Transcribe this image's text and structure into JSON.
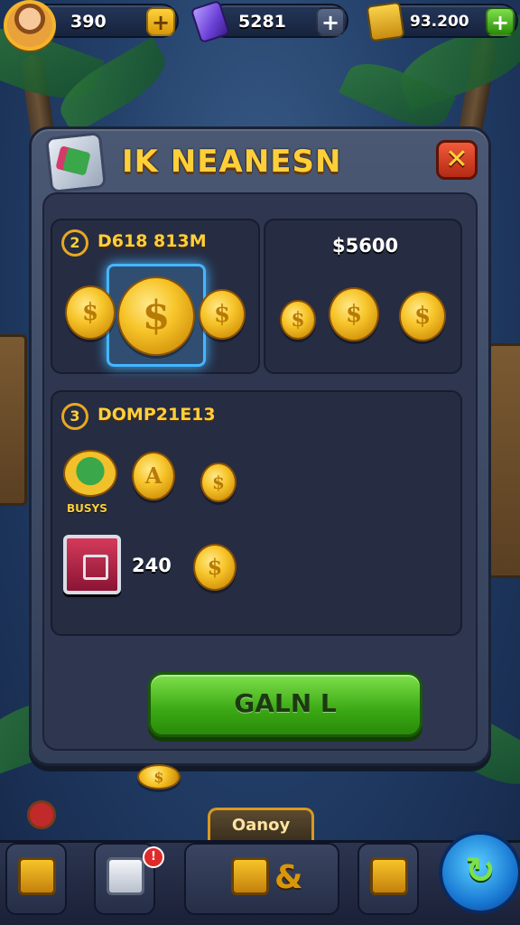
{
  "topbar": {
    "gold": "390",
    "gems": "5281",
    "cash": "93.200",
    "plus": "+"
  },
  "panel": {
    "title": "IK NEANESN",
    "close": "✕",
    "section1": {
      "number": "2",
      "label": "D618 813M",
      "price": "$5600"
    },
    "section2": {
      "number": "3",
      "label": "DOMP21E13",
      "cash_label": "BUSYS",
      "chest_count": "240"
    },
    "cta": "GALN L"
  },
  "coin_symbol": "$",
  "coin_symbol_alt": "A",
  "bottom": {
    "center_tab": "Oanoy",
    "badge_icon": "!",
    "action_icon": "&"
  },
  "colors": {
    "accent": "#ffcf3a",
    "cta": "#3aa814",
    "close": "#d43a1e",
    "panel": "#3d4963"
  }
}
